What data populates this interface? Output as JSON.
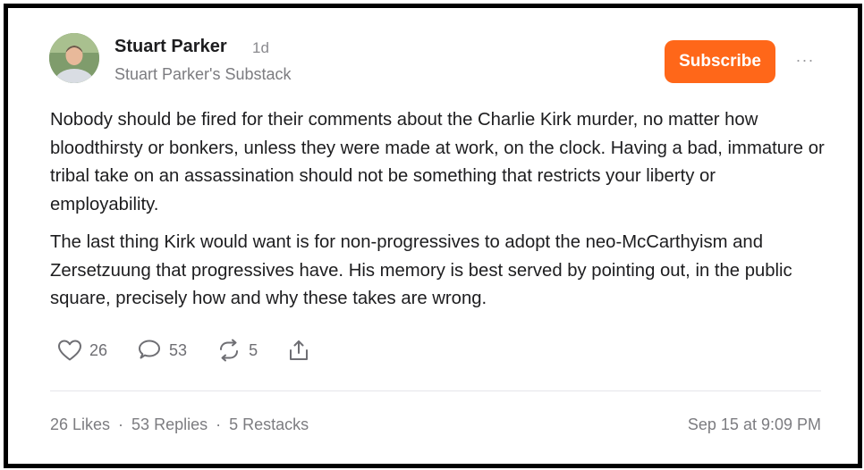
{
  "post": {
    "author": "Stuart Parker",
    "time_ago": "1d",
    "publication": "Stuart Parker's Substack",
    "subscribe_label": "Subscribe",
    "more_label": "···",
    "paragraphs": [
      "Nobody should be fired for their comments about the Charlie Kirk murder, no matter how bloodthirsty or bonkers, unless they were made at work, on the clock. Having a bad, immature or tribal take on an assassination should not be something that restricts your liberty or employability.",
      "The last thing Kirk would want is for non-progressives to adopt the neo-McCarthyism and Zersetzuung that progressives have. His memory is best served by pointing out, in the public square, precisely how and why these takes are wrong."
    ]
  },
  "actions": {
    "likes": "26",
    "replies": "53",
    "restacks": "5"
  },
  "footer": {
    "likes": "26 Likes",
    "replies": "53 Replies",
    "restacks": "5 Restacks",
    "separator": "·",
    "timestamp": "Sep 15 at 9:09 PM"
  },
  "colors": {
    "accent": "#ff6719",
    "text": "#1d1d1f",
    "muted": "#7c7c80"
  }
}
